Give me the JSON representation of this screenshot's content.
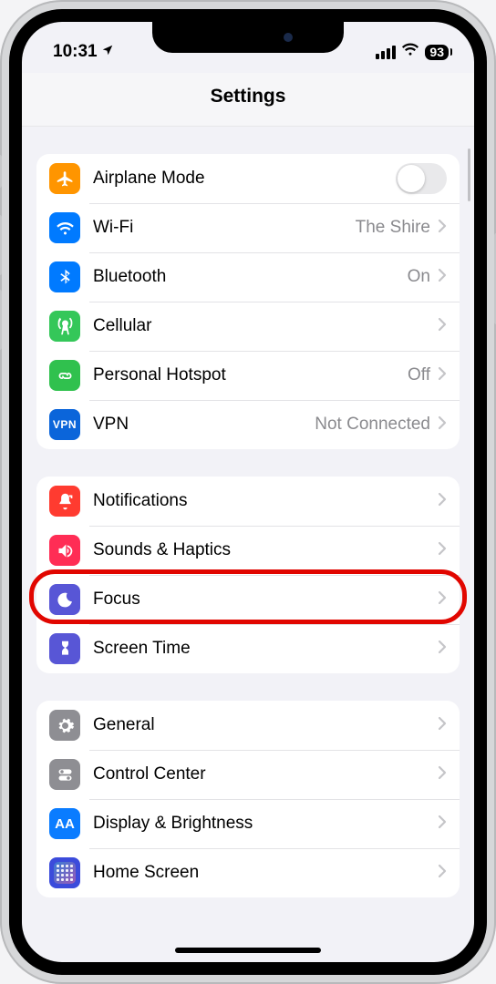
{
  "statusbar": {
    "time": "10:31",
    "battery": "93"
  },
  "title": "Settings",
  "groups": [
    {
      "rows": [
        {
          "id": "airplane",
          "label": "Airplane Mode",
          "value": "",
          "toggle": true
        },
        {
          "id": "wifi",
          "label": "Wi-Fi",
          "value": "The Shire"
        },
        {
          "id": "bluetooth",
          "label": "Bluetooth",
          "value": "On"
        },
        {
          "id": "cellular",
          "label": "Cellular",
          "value": ""
        },
        {
          "id": "hotspot",
          "label": "Personal Hotspot",
          "value": "Off"
        },
        {
          "id": "vpn",
          "label": "VPN",
          "value": "Not Connected"
        }
      ]
    },
    {
      "rows": [
        {
          "id": "notifications",
          "label": "Notifications",
          "value": ""
        },
        {
          "id": "sounds",
          "label": "Sounds & Haptics",
          "value": ""
        },
        {
          "id": "focus",
          "label": "Focus",
          "value": "",
          "highlight": true
        },
        {
          "id": "screentime",
          "label": "Screen Time",
          "value": ""
        }
      ]
    },
    {
      "rows": [
        {
          "id": "general",
          "label": "General",
          "value": ""
        },
        {
          "id": "controlcenter",
          "label": "Control Center",
          "value": ""
        },
        {
          "id": "display",
          "label": "Display & Brightness",
          "value": ""
        },
        {
          "id": "homescreen",
          "label": "Home Screen",
          "value": ""
        }
      ]
    }
  ]
}
